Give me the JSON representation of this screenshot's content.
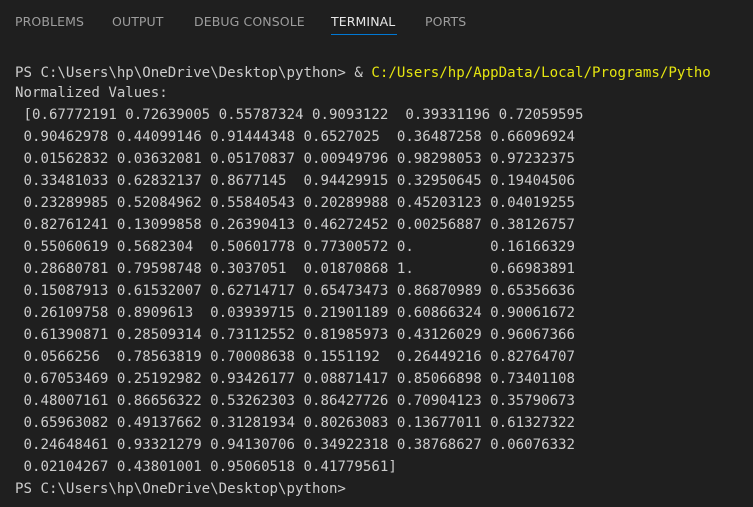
{
  "tabs": [
    {
      "label": "PROBLEMS",
      "active": false
    },
    {
      "label": "OUTPUT",
      "active": false
    },
    {
      "label": "DEBUG CONSOLE",
      "active": false
    },
    {
      "label": "TERMINAL",
      "active": true
    },
    {
      "label": "PORTS",
      "active": false
    }
  ],
  "terminal": {
    "command_prompt": "PS C:\\Users\\hp\\OneDrive\\Desktop\\python> & ",
    "command_path": "C:/Users/hp/AppData/Local/Programs/Pytho",
    "output_lines": [
      "Normalized Values:",
      " [0.67772191 0.72639005 0.55787324 0.9093122  0.39331196 0.72059595",
      " 0.90462978 0.44099146 0.91444348 0.6527025  0.36487258 0.66096924",
      " 0.01562832 0.03632081 0.05170837 0.00949796 0.98298053 0.97232375",
      " 0.33481033 0.62832137 0.8677145  0.94429915 0.32950645 0.19404506",
      " 0.23289985 0.52084962 0.55840543 0.20289988 0.45203123 0.04019255",
      " 0.82761241 0.13099858 0.26390413 0.46272452 0.00256887 0.38126757",
      " 0.55060619 0.5682304  0.50601778 0.77300572 0.         0.16166329",
      " 0.28680781 0.79598748 0.3037051  0.01870868 1.         0.66983891",
      " 0.15087913 0.61532007 0.62714717 0.65473473 0.86870989 0.65356636",
      " 0.26109758 0.8909613  0.03939715 0.21901189 0.60866324 0.90061672",
      " 0.61390871 0.28509314 0.73112552 0.81985973 0.43126029 0.96067366",
      " 0.0566256  0.78563819 0.70008638 0.1551192  0.26449216 0.82764707",
      " 0.67053469 0.25192982 0.93426177 0.08871417 0.85066898 0.73401108",
      " 0.48007161 0.86656322 0.53262303 0.86427726 0.70904123 0.35790673",
      " 0.65963082 0.49137662 0.31281934 0.80263083 0.13677011 0.61327322",
      " 0.24648461 0.93321279 0.94130706 0.34922318 0.38768627 0.06076332",
      " 0.02104267 0.43801001 0.95060518 0.41779561]"
    ],
    "final_prompt": "PS C:\\Users\\hp\\OneDrive\\Desktop\\python>"
  },
  "colors": {
    "background": "#1f1f1f",
    "text": "#cccccc",
    "tab_inactive": "#9d9d9d",
    "tab_active": "#e7e7e7",
    "tab_underline": "#0078d4",
    "command_path": "#e5e510"
  }
}
